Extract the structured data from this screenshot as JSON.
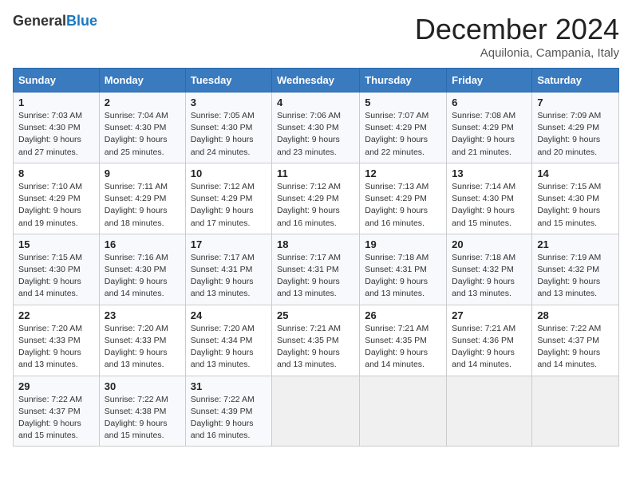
{
  "header": {
    "logo_general": "General",
    "logo_blue": "Blue",
    "title": "December 2024",
    "location": "Aquilonia, Campania, Italy"
  },
  "days_of_week": [
    "Sunday",
    "Monday",
    "Tuesday",
    "Wednesday",
    "Thursday",
    "Friday",
    "Saturday"
  ],
  "weeks": [
    [
      {
        "day": "1",
        "sunrise": "7:03 AM",
        "sunset": "4:30 PM",
        "daylight": "9 hours and 27 minutes."
      },
      {
        "day": "2",
        "sunrise": "7:04 AM",
        "sunset": "4:30 PM",
        "daylight": "9 hours and 25 minutes."
      },
      {
        "day": "3",
        "sunrise": "7:05 AM",
        "sunset": "4:30 PM",
        "daylight": "9 hours and 24 minutes."
      },
      {
        "day": "4",
        "sunrise": "7:06 AM",
        "sunset": "4:30 PM",
        "daylight": "9 hours and 23 minutes."
      },
      {
        "day": "5",
        "sunrise": "7:07 AM",
        "sunset": "4:29 PM",
        "daylight": "9 hours and 22 minutes."
      },
      {
        "day": "6",
        "sunrise": "7:08 AM",
        "sunset": "4:29 PM",
        "daylight": "9 hours and 21 minutes."
      },
      {
        "day": "7",
        "sunrise": "7:09 AM",
        "sunset": "4:29 PM",
        "daylight": "9 hours and 20 minutes."
      }
    ],
    [
      {
        "day": "8",
        "sunrise": "7:10 AM",
        "sunset": "4:29 PM",
        "daylight": "9 hours and 19 minutes."
      },
      {
        "day": "9",
        "sunrise": "7:11 AM",
        "sunset": "4:29 PM",
        "daylight": "9 hours and 18 minutes."
      },
      {
        "day": "10",
        "sunrise": "7:12 AM",
        "sunset": "4:29 PM",
        "daylight": "9 hours and 17 minutes."
      },
      {
        "day": "11",
        "sunrise": "7:12 AM",
        "sunset": "4:29 PM",
        "daylight": "9 hours and 16 minutes."
      },
      {
        "day": "12",
        "sunrise": "7:13 AM",
        "sunset": "4:29 PM",
        "daylight": "9 hours and 16 minutes."
      },
      {
        "day": "13",
        "sunrise": "7:14 AM",
        "sunset": "4:30 PM",
        "daylight": "9 hours and 15 minutes."
      },
      {
        "day": "14",
        "sunrise": "7:15 AM",
        "sunset": "4:30 PM",
        "daylight": "9 hours and 15 minutes."
      }
    ],
    [
      {
        "day": "15",
        "sunrise": "7:15 AM",
        "sunset": "4:30 PM",
        "daylight": "9 hours and 14 minutes."
      },
      {
        "day": "16",
        "sunrise": "7:16 AM",
        "sunset": "4:30 PM",
        "daylight": "9 hours and 14 minutes."
      },
      {
        "day": "17",
        "sunrise": "7:17 AM",
        "sunset": "4:31 PM",
        "daylight": "9 hours and 13 minutes."
      },
      {
        "day": "18",
        "sunrise": "7:17 AM",
        "sunset": "4:31 PM",
        "daylight": "9 hours and 13 minutes."
      },
      {
        "day": "19",
        "sunrise": "7:18 AM",
        "sunset": "4:31 PM",
        "daylight": "9 hours and 13 minutes."
      },
      {
        "day": "20",
        "sunrise": "7:18 AM",
        "sunset": "4:32 PM",
        "daylight": "9 hours and 13 minutes."
      },
      {
        "day": "21",
        "sunrise": "7:19 AM",
        "sunset": "4:32 PM",
        "daylight": "9 hours and 13 minutes."
      }
    ],
    [
      {
        "day": "22",
        "sunrise": "7:20 AM",
        "sunset": "4:33 PM",
        "daylight": "9 hours and 13 minutes."
      },
      {
        "day": "23",
        "sunrise": "7:20 AM",
        "sunset": "4:33 PM",
        "daylight": "9 hours and 13 minutes."
      },
      {
        "day": "24",
        "sunrise": "7:20 AM",
        "sunset": "4:34 PM",
        "daylight": "9 hours and 13 minutes."
      },
      {
        "day": "25",
        "sunrise": "7:21 AM",
        "sunset": "4:35 PM",
        "daylight": "9 hours and 13 minutes."
      },
      {
        "day": "26",
        "sunrise": "7:21 AM",
        "sunset": "4:35 PM",
        "daylight": "9 hours and 14 minutes."
      },
      {
        "day": "27",
        "sunrise": "7:21 AM",
        "sunset": "4:36 PM",
        "daylight": "9 hours and 14 minutes."
      },
      {
        "day": "28",
        "sunrise": "7:22 AM",
        "sunset": "4:37 PM",
        "daylight": "9 hours and 14 minutes."
      }
    ],
    [
      {
        "day": "29",
        "sunrise": "7:22 AM",
        "sunset": "4:37 PM",
        "daylight": "9 hours and 15 minutes."
      },
      {
        "day": "30",
        "sunrise": "7:22 AM",
        "sunset": "4:38 PM",
        "daylight": "9 hours and 15 minutes."
      },
      {
        "day": "31",
        "sunrise": "7:22 AM",
        "sunset": "4:39 PM",
        "daylight": "9 hours and 16 minutes."
      },
      null,
      null,
      null,
      null
    ]
  ]
}
